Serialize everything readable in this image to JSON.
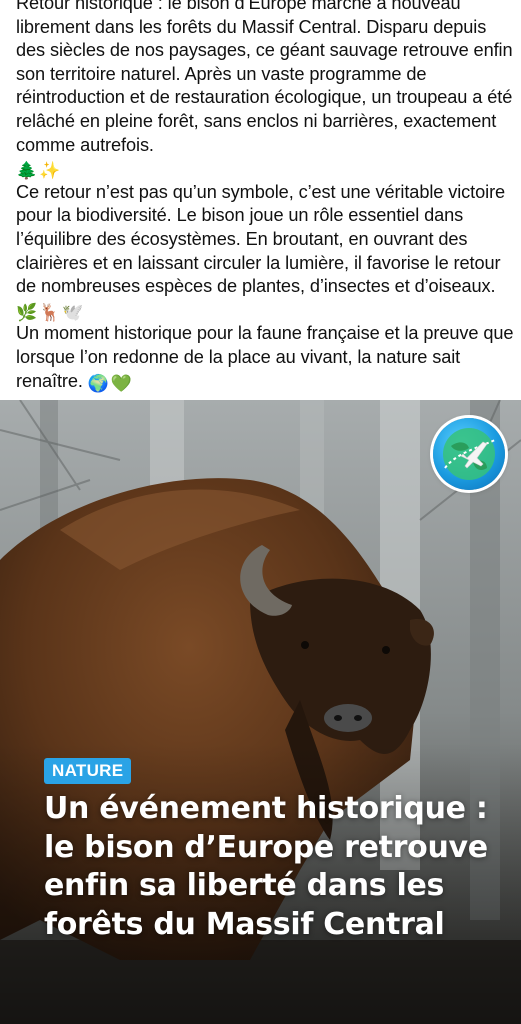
{
  "post": {
    "paragraphs": [
      "Retour historique : le bison d’Europe marche à nouveau librement dans les forêts du Massif Central. Disparu depuis des siècles de nos paysages, ce géant sauvage retrouve enfin son territoire naturel. Après un vaste programme de réintroduction et de restauration écologique, un troupeau a été relâché en pleine forêt, sans enclos ni barrières, exactement comme autrefois.",
      "Ce retour n’est pas qu’un symbole, c’est une véritable victoire pour la biodiversité. Le bison joue un rôle essentiel dans l’équilibre des écosystèmes. En broutant, en ouvrant des clairières et en laissant circuler la lumière, il favorise le retour de nombreuses espèces de plantes, d’insectes et d’oiseaux.",
      "Un moment historique pour la faune française et la preuve que lorsque l’on redonne de la place au vivant, la nature sait renaître."
    ],
    "emojis": {
      "p1": [
        "🌲",
        "✨"
      ],
      "p2": [
        "🌿",
        "🦌",
        "🕊️"
      ],
      "p3": [
        "🌍",
        "💚"
      ]
    }
  },
  "card": {
    "tag": "NATURE",
    "headline": "Un événement historique : le bison d’Europe retrouve enfin sa liberté dans les forêts du Massif Central",
    "logo_icon": "globe-airplane-icon",
    "tag_color": "#2aa3e6"
  }
}
